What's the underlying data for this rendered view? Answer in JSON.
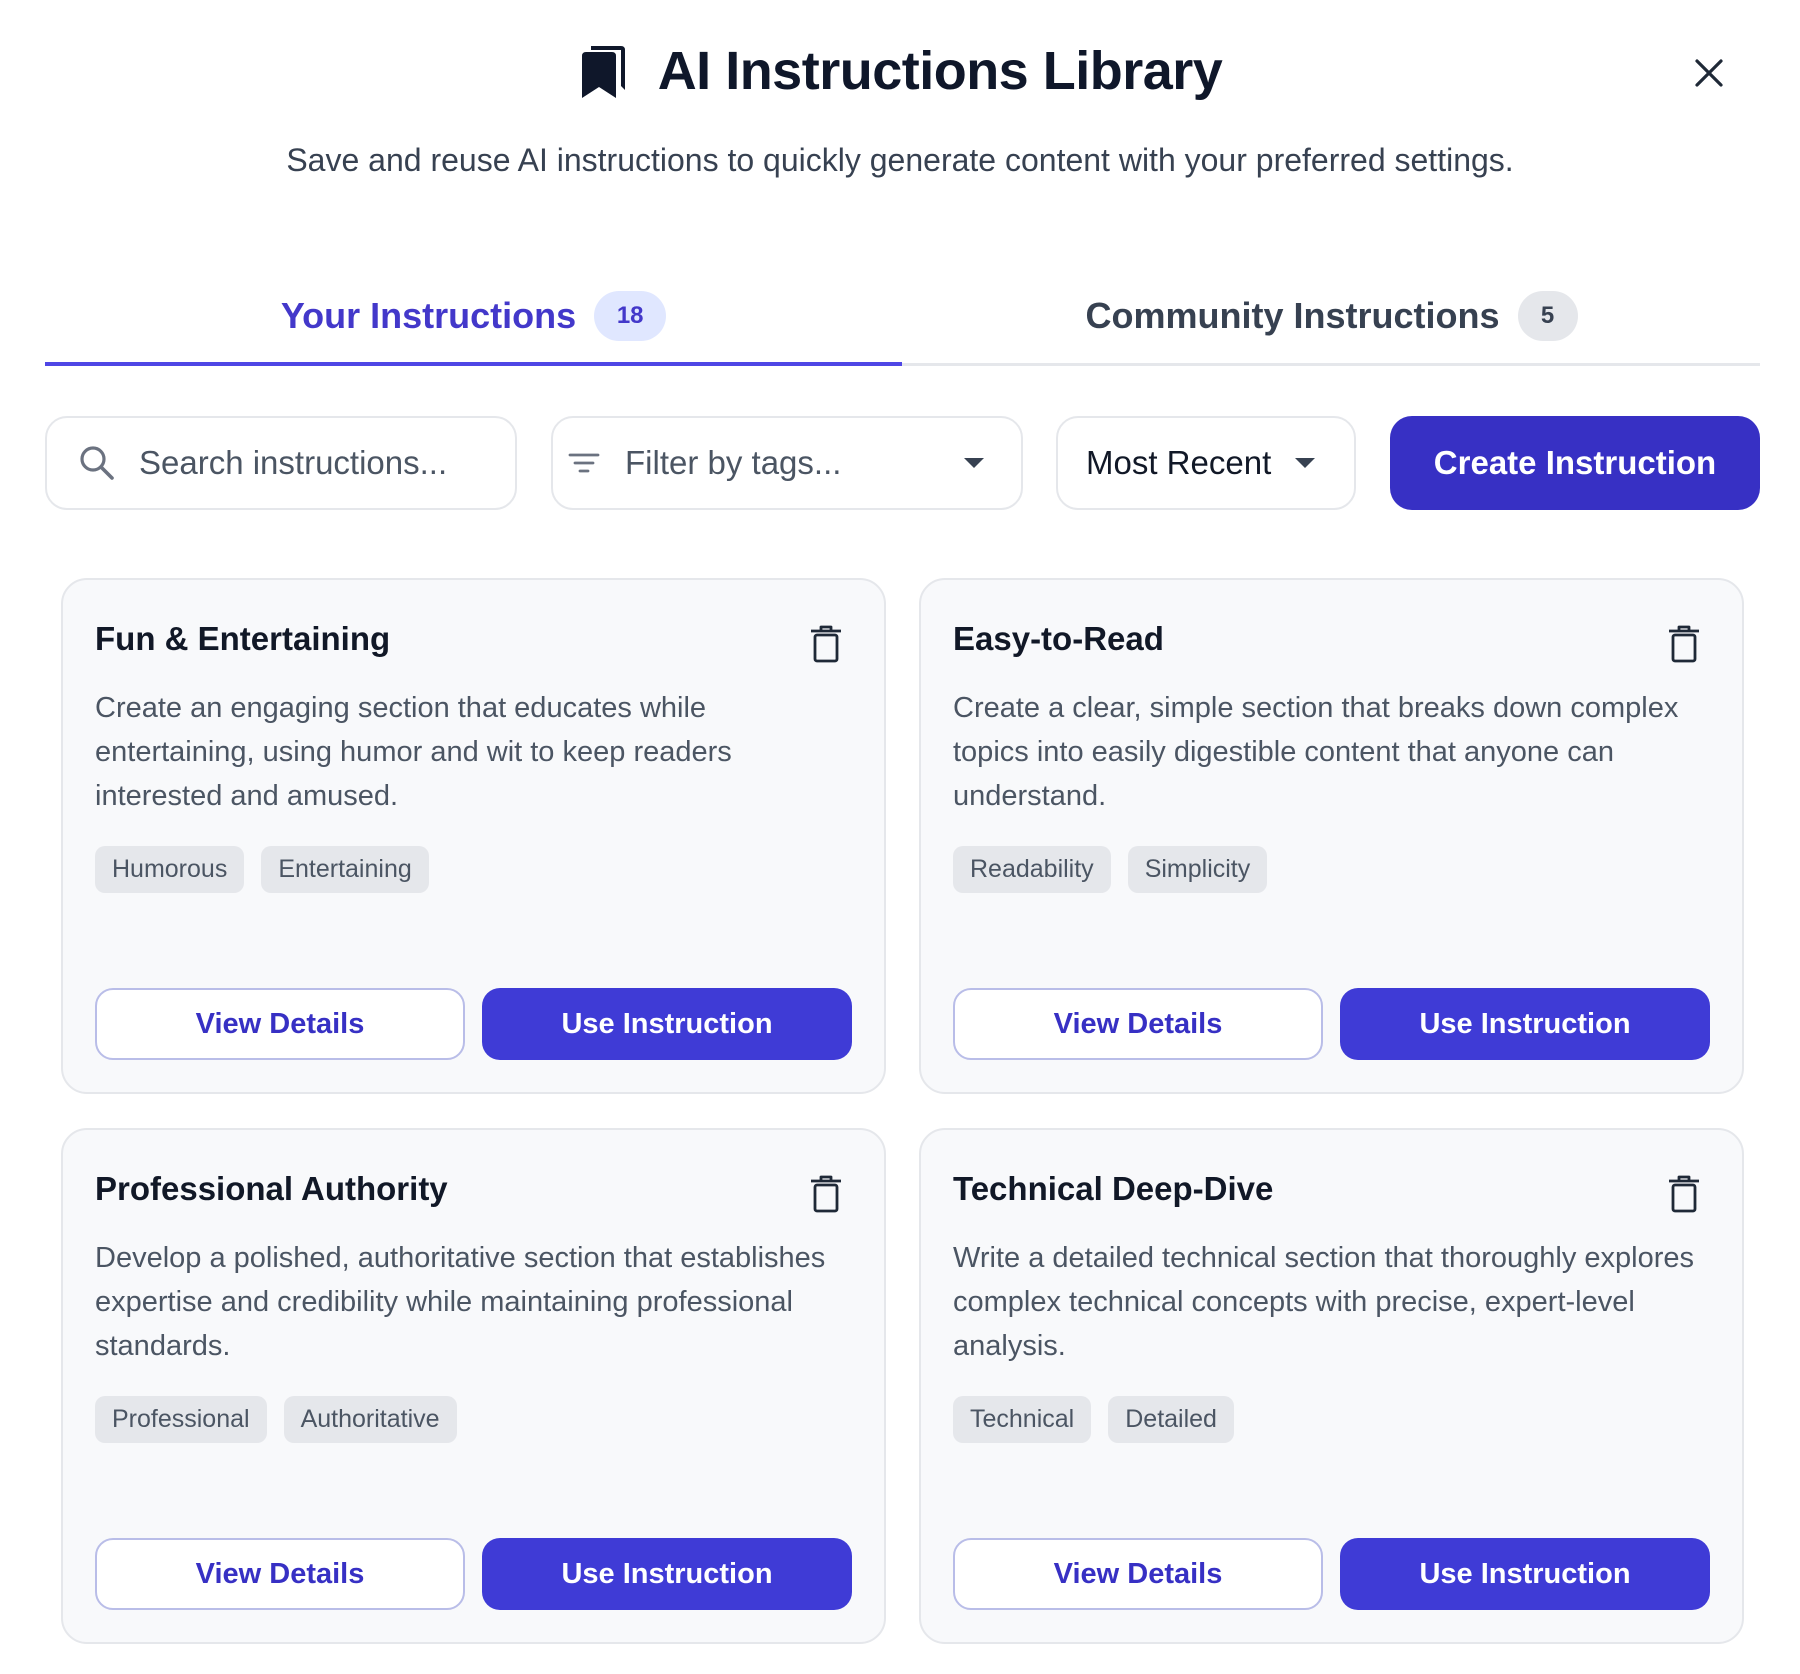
{
  "header": {
    "title": "AI Instructions Library",
    "subtitle": "Save and reuse AI instructions to quickly generate content with your preferred settings.",
    "title_icon": "bookmarks-icon",
    "close_icon": "close-icon"
  },
  "tabs": [
    {
      "label": "Your Instructions",
      "count": "18",
      "active": true
    },
    {
      "label": "Community Instructions",
      "count": "5",
      "active": false
    }
  ],
  "controls": {
    "search_placeholder": "Search instructions...",
    "filter_label": "Filter by tags...",
    "sort_label": "Most Recent",
    "create_label": "Create Instruction"
  },
  "cards": [
    {
      "title": "Fun & Entertaining",
      "description": "Create an engaging section that educates while entertaining, using humor and wit to keep readers interested and amused.",
      "tags": [
        "Humorous",
        "Entertaining"
      ],
      "view_label": "View Details",
      "use_label": "Use Instruction"
    },
    {
      "title": "Easy-to-Read",
      "description": "Create a clear, simple section that breaks down complex topics into easily digestible content that anyone can understand.",
      "tags": [
        "Readability",
        "Simplicity"
      ],
      "view_label": "View Details",
      "use_label": "Use Instruction"
    },
    {
      "title": "Professional Authority",
      "description": "Develop a polished, authoritative section that establishes expertise and credibility while maintaining professional standards.",
      "tags": [
        "Professional",
        "Authoritative"
      ],
      "view_label": "View Details",
      "use_label": "Use Instruction"
    },
    {
      "title": "Technical Deep-Dive",
      "description": "Write a detailed technical section that thoroughly explores complex technical concepts with precise, expert-level analysis.",
      "tags": [
        "Technical",
        "Detailed"
      ],
      "view_label": "View Details",
      "use_label": "Use Instruction"
    }
  ],
  "colors": {
    "accent": "#4f46e5",
    "primary_button": "#3f3bd6",
    "create_button": "#3730c4",
    "card_background": "#f8f9fb",
    "tag_background": "#e5e7eb"
  }
}
